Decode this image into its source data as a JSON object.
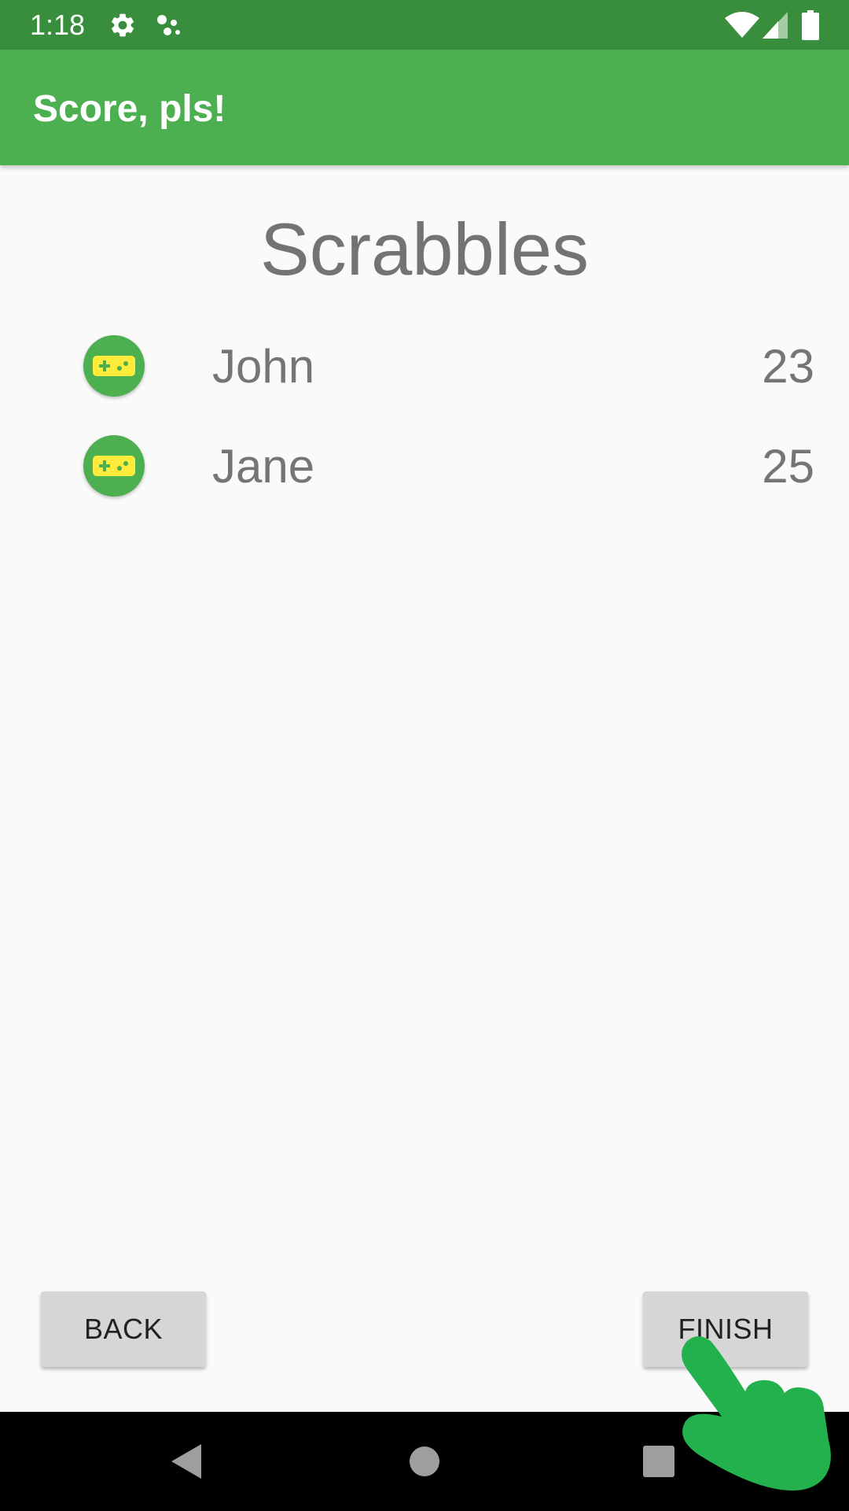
{
  "status_bar": {
    "time": "1:18",
    "icons": [
      "gear-icon",
      "assistant-dots-icon",
      "wifi-icon",
      "cell-signal-icon",
      "battery-icon"
    ]
  },
  "app_bar": {
    "title": "Score, pls!"
  },
  "game": {
    "title": "Scrabbles",
    "players": [
      {
        "name": "John",
        "score": "23",
        "icon": "gamepad-icon"
      },
      {
        "name": "Jane",
        "score": "25",
        "icon": "gamepad-icon"
      }
    ]
  },
  "buttons": {
    "back_label": "BACK",
    "finish_label": "FINISH"
  },
  "nav_bar": {
    "icons": [
      "back-triangle-icon",
      "home-circle-icon",
      "recents-square-icon"
    ]
  },
  "colors": {
    "status_bar": "#388e3c",
    "app_bar": "#4caf50",
    "accent_yellow": "#ffeb3b",
    "touch_indicator": "#22b14c"
  }
}
